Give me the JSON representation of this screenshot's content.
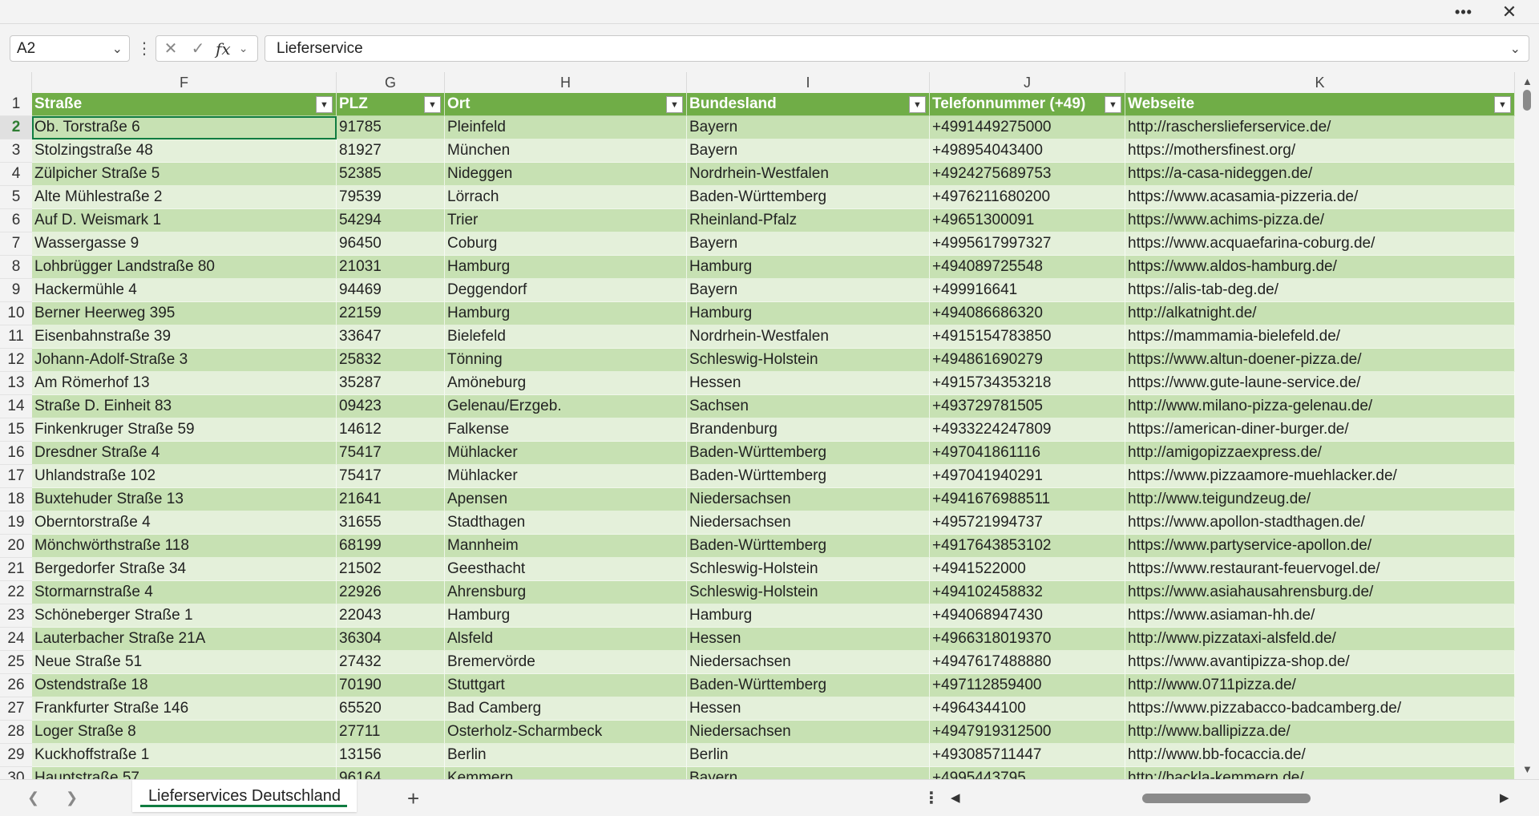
{
  "window": {
    "more_icon": "more-horizontal-icon",
    "close_icon": "close-icon"
  },
  "formula_bar": {
    "name_box": "A2",
    "fx_label": "fx",
    "formula": "Lieferservice"
  },
  "column_letters": [
    "F",
    "G",
    "H",
    "I",
    "J",
    "K"
  ],
  "table": {
    "headers": [
      "Straße",
      "PLZ",
      "Ort",
      "Bundesland",
      "Telefonnummer (+49)",
      "Webseite"
    ],
    "rows": [
      [
        "Ob. Torstraße 6",
        "91785",
        "Pleinfeld",
        "Bayern",
        "+4991449275000",
        "http://raschers­lieferservice.de/"
      ],
      [
        "Stolzingstraße 48",
        "81927",
        "München",
        "Bayern",
        "+498954043400",
        "https://mothersfinest.org/"
      ],
      [
        "Zülpicher Straße 5",
        "52385",
        "Nideggen",
        "Nordrhein-Westfalen",
        "+4924275689753",
        "https://a-casa-nideggen.de/"
      ],
      [
        "Alte Mühlestraße 2",
        "79539",
        "Lörrach",
        "Baden-Württemberg",
        "+4976211680200",
        "https://www.acasamia-pizzeria.de/"
      ],
      [
        "Auf D. Weismark 1",
        "54294",
        "Trier",
        "Rheinland-Pfalz",
        "+49651300091",
        "https://www.achims-pizza.de/"
      ],
      [
        "Wassergasse 9",
        "96450",
        "Coburg",
        "Bayern",
        "+4995617997327",
        "https://www.acquaefarina-coburg.de/"
      ],
      [
        "Lohbrügger Landstraße 80",
        "21031",
        "Hamburg",
        "Hamburg",
        "+494089725548",
        "https://www.aldos-hamburg.de/"
      ],
      [
        "Hackermühle 4",
        "94469",
        "Deggendorf",
        "Bayern",
        "+499916641",
        "https://alis-tab-deg.de/"
      ],
      [
        "Berner Heerweg 395",
        "22159",
        "Hamburg",
        "Hamburg",
        "+494086686320",
        "http://alkatnight.de/"
      ],
      [
        "Eisenbahnstraße 39",
        "33647",
        "Bielefeld",
        "Nordrhein-Westfalen",
        "+4915154783850",
        "https://mammamia-bielefeld.de/"
      ],
      [
        "Johann-Adolf-Straße 3",
        "25832",
        "Tönning",
        "Schleswig-Holstein",
        "+494861690279",
        "https://www.altun-doener-pizza.de/"
      ],
      [
        "Am Römerhof 13",
        "35287",
        "Amöneburg",
        "Hessen",
        "+4915734353218",
        "https://www.gute-laune-service.de/"
      ],
      [
        "Straße D. Einheit 83",
        "09423",
        "Gelenau/Erzgeb.",
        "Sachsen",
        "+493729781505",
        "http://www.milano-pizza-gelenau.de/"
      ],
      [
        "Finkenkruger Straße 59",
        "14612",
        "Falkense",
        "Brandenburg",
        "+4933224247809",
        "https://american-diner-burger.de/"
      ],
      [
        "Dresdner Straße 4",
        "75417",
        "Mühlacker",
        "Baden-Württemberg",
        "+497041861116",
        "http://amigopizzaexpress.de/"
      ],
      [
        "Uhlandstraße 102",
        "75417",
        "Mühlacker",
        "Baden-Württemberg",
        "+497041940291",
        "https://www.pizzaamore-muehlacker.de/"
      ],
      [
        "Buxtehuder Straße 13",
        "21641",
        "Apensen",
        "Niedersachsen",
        "+4941676988511",
        "http://www.teigundzeug.de/"
      ],
      [
        "Oberntorstraße 4",
        "31655",
        "Stadthagen",
        "Niedersachsen",
        "+495721994737",
        "https://www.apollon-stadthagen.de/"
      ],
      [
        "Mönchwörthstraße 118",
        "68199",
        "Mannheim",
        "Baden-Württemberg",
        "+4917643853102",
        "https://www.partyservice-apollon.de/"
      ],
      [
        "Bergedorfer Straße 34",
        "21502",
        "Geesthacht",
        "Schleswig-Holstein",
        "+4941522000",
        "https://www.restaurant-feuervogel.de/"
      ],
      [
        "Stormarnstraße 4",
        "22926",
        "Ahrensburg",
        "Schleswig-Holstein",
        "+494102458832",
        "https://www.asiahausahrensburg.de/"
      ],
      [
        "Schöneberger Straße 1",
        "22043",
        "Hamburg",
        "Hamburg",
        "+494068947430",
        "https://www.asiaman-hh.de/"
      ],
      [
        "Lauterbacher Straße 21A",
        "36304",
        "Alsfeld",
        "Hessen",
        "+4966318019370",
        "http://www.pizzataxi-alsfeld.de/"
      ],
      [
        "Neue Straße 51",
        "27432",
        "Bremervörde",
        "Niedersachsen",
        "+4947617488880",
        "https://www.avantipizza-shop.de/"
      ],
      [
        "Ostendstraße 18",
        "70190",
        "Stuttgart",
        "Baden-Württemberg",
        "+497112859400",
        "http://www.0711pizza.de/"
      ],
      [
        "Frankfurter Straße 146",
        "65520",
        "Bad Camberg",
        "Hessen",
        "+4964344100",
        "https://www.pizzabacco-badcamberg.de/"
      ],
      [
        "Loger Straße 8",
        "27711",
        "Osterholz-Scharmbeck",
        "Niedersachsen",
        "+4947919312500",
        "http://www.ballipizza.de/"
      ],
      [
        "Kuckhoffstraße 1",
        "13156",
        "Berlin",
        "Berlin",
        "+493085711447",
        "http://www.bb-focaccia.de/"
      ],
      [
        "Hauptstraße 57",
        "96164",
        "Kemmern",
        "Bayern",
        "+4995443795",
        "http://backla-kemmern.de/"
      ]
    ]
  },
  "sheet_tabs": {
    "active": "Lieferservices Deutschland",
    "add_icon": "plus-icon"
  }
}
